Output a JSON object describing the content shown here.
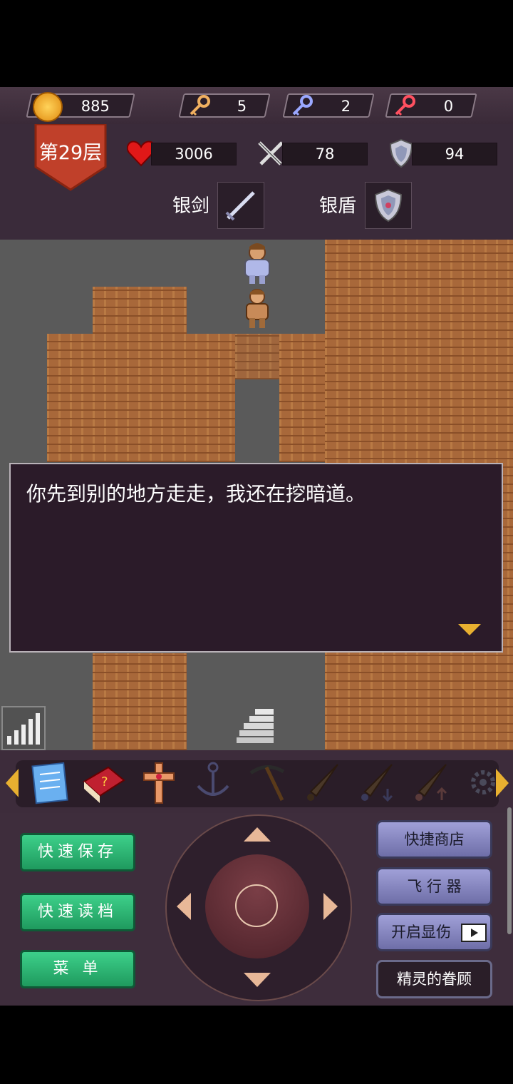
{
  "hud": {
    "gold": "885",
    "yellow_keys": "5",
    "blue_keys": "2",
    "red_keys": "0",
    "floor": "第29层",
    "hp": "3006",
    "attack": "78",
    "defense": "94",
    "weapon_label": "银剑",
    "shield_label": "银盾"
  },
  "dialog": {
    "text": "你先到别的地方走走，我还在挖暗道。"
  },
  "items": [
    "notepad-icon",
    "monster-book-icon",
    "holy-cross-icon",
    "anchor-icon",
    "pickaxe-icon",
    "feather-icon",
    "feather-down-icon",
    "feather-up-icon",
    "gear-icon"
  ],
  "controls": {
    "quick_save": "快速保存",
    "quick_load": "快速读档",
    "menu": "菜 单",
    "quick_shop": "快捷商店",
    "flyer": "飞 行 器",
    "show_damage": "开启显伤",
    "spirit_favor": "精灵的眷顾"
  },
  "colors": {
    "accent_green": "#2fb573",
    "accent_purple": "#8a8ac4",
    "floor_badge": "#c0402a"
  }
}
